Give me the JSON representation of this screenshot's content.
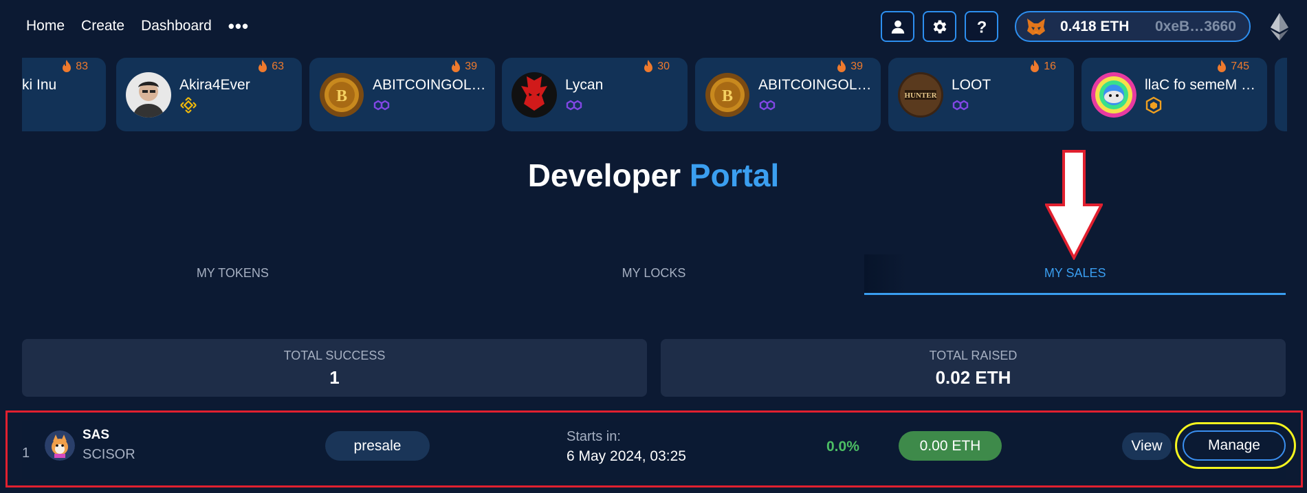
{
  "nav": {
    "links": [
      "Home",
      "Create",
      "Dashboard"
    ],
    "more": "•••",
    "icons": [
      "user-icon",
      "settings-icon",
      "help-icon"
    ]
  },
  "wallet": {
    "balance": "0.418 ETH",
    "address": "0xeB…3660",
    "icon": "metamask-fox-icon",
    "network_icon": "ethereum-icon"
  },
  "trending": [
    {
      "name": "ki Inu",
      "hot": "83"
    },
    {
      "name": "Akira4Ever",
      "hot": "63",
      "chain": "bnb"
    },
    {
      "name": "ABITCOINGOL…",
      "hot": "39",
      "chain": "polygon"
    },
    {
      "name": "Lycan",
      "hot": "30",
      "chain": "polygon"
    },
    {
      "name": "ABITCOINGOL…",
      "hot": "39",
      "chain": "polygon"
    },
    {
      "name": "LOOT",
      "hot": "16",
      "chain": "polygon"
    },
    {
      "name": "llaC fo semeM …",
      "hot": "745",
      "chain": "hexagon"
    }
  ],
  "title": {
    "part1": "Developer",
    "part2": "Portal"
  },
  "tabs": [
    "MY TOKENS",
    "MY LOCKS",
    "MY SALES"
  ],
  "active_tab": "MY SALES",
  "stats": {
    "success_label": "TOTAL SUCCESS",
    "success_value": "1",
    "raised_label": "TOTAL RAISED",
    "raised_value": "0.02 ETH"
  },
  "sale": {
    "index": "1",
    "symbol": "SAS",
    "name": "SCISOR",
    "type": "presale",
    "starts_label": "Starts in:",
    "starts_value": "6 May 2024, 03:25",
    "percent": "0.0%",
    "raised": "0.00 ETH",
    "view_label": "View",
    "manage_label": "Manage"
  },
  "colors": {
    "accent": "#3a9ef0",
    "background": "#0c1a33",
    "card": "#123257",
    "hot": "#ef7a2d",
    "success": "#4cbe64",
    "annotation_red": "#e1202f",
    "annotation_yellow": "#f5f51e"
  }
}
